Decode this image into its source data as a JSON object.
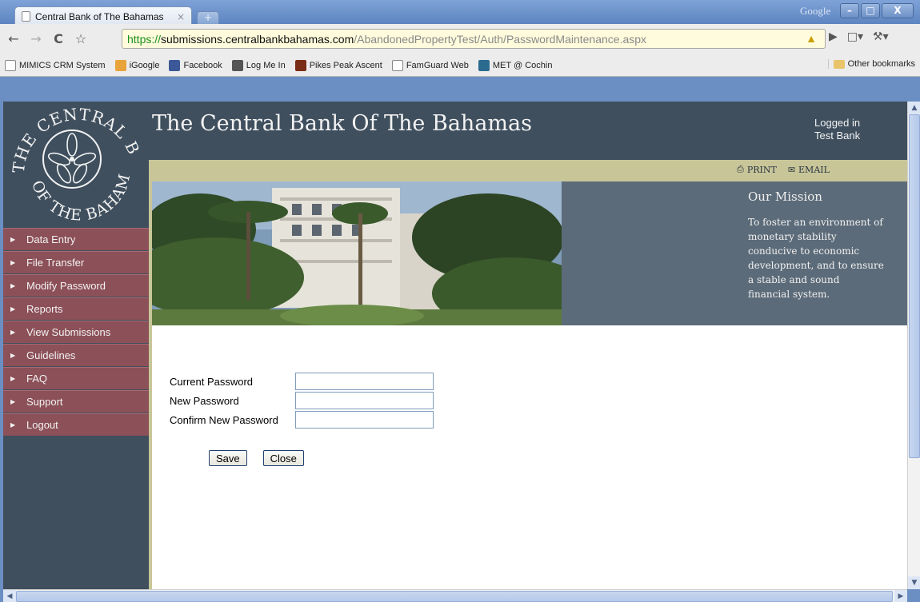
{
  "browser": {
    "tab_title": "Central Bank of The Bahamas",
    "tab_close": "×",
    "new_tab": "+",
    "google_label": "Google",
    "window_buttons": [
      "–",
      "□",
      "X"
    ],
    "url": {
      "scheme": "https://",
      "host": "submissions.centralbankbahamas.com",
      "path": "/AbandonedPropertyTest/Auth/PasswordMaintenance.aspx"
    },
    "bookmarks": [
      {
        "label": "MIMICS CRM System",
        "icon": "page-icon",
        "color": "#ffffff"
      },
      {
        "label": "iGoogle",
        "icon": "igoogle-icon",
        "color": "#e8a33b"
      },
      {
        "label": "Facebook",
        "icon": "facebook-icon",
        "color": "#3b5998"
      },
      {
        "label": "Log Me In",
        "icon": "logmein-icon",
        "color": "#555555"
      },
      {
        "label": "Pikes Peak Ascent",
        "icon": "pikes-peak-icon",
        "color": "#7a2d16"
      },
      {
        "label": "FamGuard Web",
        "icon": "page-icon",
        "color": "#ffffff"
      },
      {
        "label": "MET @ Cochin",
        "icon": "wordpress-icon",
        "color": "#2b6b8f"
      }
    ],
    "other_bookmarks": "Other bookmarks"
  },
  "site": {
    "title": "The Central Bank Of The Bahamas",
    "logged_in_line1": "Logged in",
    "logged_in_line2": "Test Bank",
    "print_label": "PRINT",
    "email_label": "EMAIL",
    "logo_text_top": "THE CENTRAL BANK",
    "logo_text_bottom": "OF THE BAHAMAS"
  },
  "mission": {
    "title": "Our Mission",
    "text": "To foster an environment of monetary stability conducive to economic development, and to ensure a stable and sound financial system."
  },
  "sidebar": {
    "items": [
      {
        "label": "Data Entry"
      },
      {
        "label": "File Transfer"
      },
      {
        "label": "Modify Password"
      },
      {
        "label": "Reports"
      },
      {
        "label": "View Submissions"
      },
      {
        "label": "Guidelines"
      },
      {
        "label": "FAQ"
      },
      {
        "label": "Support"
      },
      {
        "label": "Logout"
      }
    ]
  },
  "form": {
    "current_password_label": "Current Password",
    "current_password_value": "",
    "new_password_label": "New Password",
    "new_password_value": "",
    "confirm_password_label": "Confirm New Password",
    "confirm_password_value": "",
    "save_label": "Save",
    "close_label": "Close"
  },
  "colors": {
    "header_bg": "#3f4f5e",
    "nav_item_bg": "#8c5058",
    "util_bar_bg": "#c8c699",
    "mission_bg": "#5c6b79",
    "url_scheme": "#1a8f1a"
  }
}
